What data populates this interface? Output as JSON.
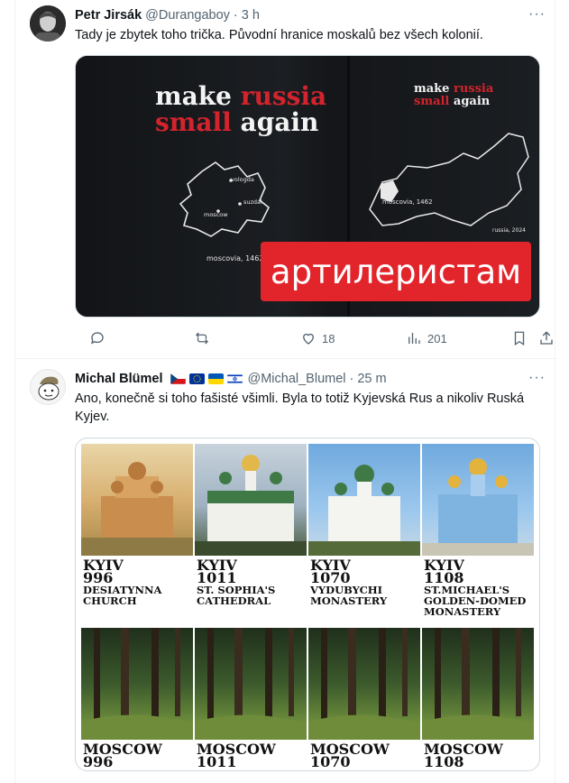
{
  "tweets": [
    {
      "author": "Petr Jirsák",
      "handle": "@Durangaboy",
      "separator": "·",
      "time": "3 h",
      "text": "Tady je zbytek toho trička. Původní hranice moskalů bez všech kolonií.",
      "media": {
        "slogan_left": [
          "make ",
          "russia",
          "small",
          " again"
        ],
        "slogan_right": [
          "make ",
          "russia",
          "small",
          " again"
        ],
        "map_labels_left": [
          "vologda",
          "suzdal",
          "moscow",
          "moscovia, 1462"
        ],
        "map_labels_right": [
          "moscovia, 1462",
          "russia, 2024"
        ],
        "banner": "артилеристам"
      },
      "actions": {
        "reply": "",
        "retweet": "",
        "likes": "18",
        "views": "201"
      }
    },
    {
      "author": "Michal Blümel",
      "handle": "@Michal_Blumel",
      "separator": "·",
      "time": "25 m",
      "text": "Ano, konečně si toho fašisté všimli. Byla to totiž Kyjevská Rus a nikoliv Ruská Kyjev.",
      "media": {
        "top_row": [
          {
            "place": "KYIV",
            "year": "996",
            "site": "DESIATYNNA CHURCH"
          },
          {
            "place": "KYIV",
            "year": "1011",
            "site": "ST. SOPHIA'S CATHEDRAL"
          },
          {
            "place": "KYIV",
            "year": "1070",
            "site": "VYDUBYCHI MONASTERY"
          },
          {
            "place": "KYIV",
            "year": "1108",
            "site": "ST.MICHAEL'S GOLDEN-DOMED MONASTERY"
          }
        ],
        "bottom_row": [
          {
            "place": "MOSCOW",
            "year": "996"
          },
          {
            "place": "MOSCOW",
            "year": "1011"
          },
          {
            "place": "MOSCOW",
            "year": "1070"
          },
          {
            "place": "MOSCOW",
            "year": "1108"
          }
        ]
      }
    }
  ],
  "more_label": "···",
  "colors": {
    "text": "#0f1419",
    "muted": "#536471",
    "border": "#eff3f4",
    "red": "#d3232d"
  }
}
